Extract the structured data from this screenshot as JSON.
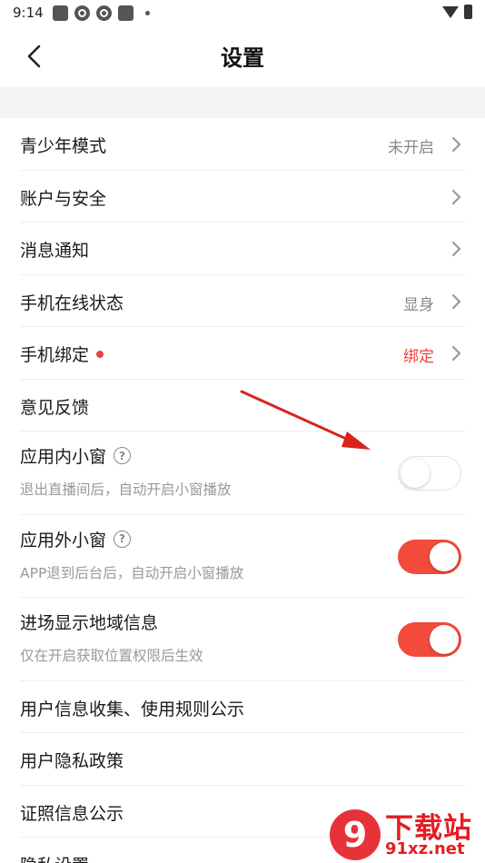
{
  "status_bar": {
    "time": "9:14"
  },
  "header": {
    "title": "设置"
  },
  "settings": {
    "items": [
      {
        "label": "青少年模式",
        "value": "未开启"
      },
      {
        "label": "账户与安全"
      },
      {
        "label": "消息通知"
      },
      {
        "label": "手机在线状态",
        "value": "显身"
      },
      {
        "label": "手机绑定",
        "value": "绑定",
        "value_color": "#ee4040"
      },
      {
        "label": "意见反馈"
      }
    ],
    "toggles": [
      {
        "label": "应用内小窗",
        "sub": "退出直播间后，自动开启小窗播放",
        "help": "?",
        "on": false
      },
      {
        "label": "应用外小窗",
        "sub": "APP退到后台后，自动开启小窗播放",
        "help": "?",
        "on": true
      },
      {
        "label": "进场显示地域信息",
        "sub": "仅在开启获取位置权限后生效",
        "on": true
      }
    ],
    "more": [
      {
        "label": "用户信息收集、使用规则公示"
      },
      {
        "label": "用户隐私政策"
      },
      {
        "label": "证照信息公示"
      },
      {
        "label": "隐私设置"
      }
    ]
  },
  "watermark": {
    "title": "下载站",
    "url": "91xz.net",
    "logo_text": "9"
  },
  "colors": {
    "accent": "#f24a3b",
    "badge": "#ee4040",
    "background_gap": "#f4f4f4"
  }
}
